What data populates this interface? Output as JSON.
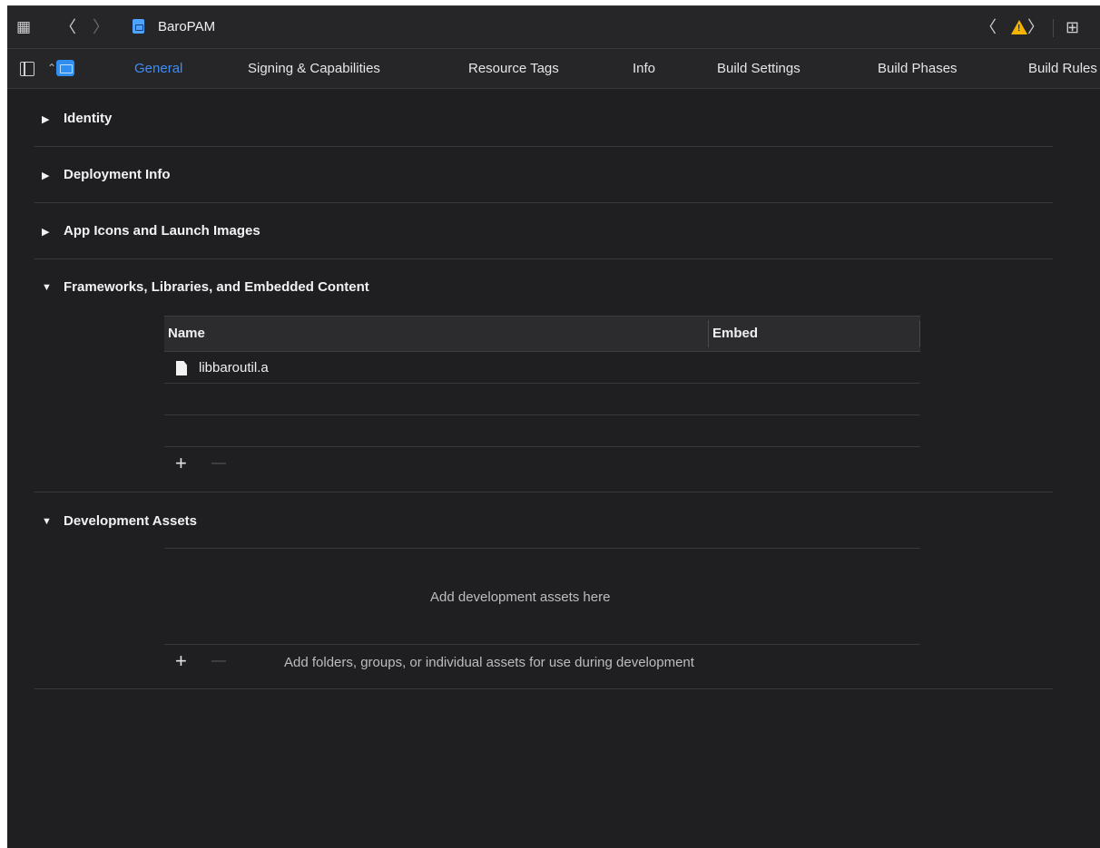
{
  "toolbar": {
    "project_name": "BaroPAM",
    "back_glyph": "〈",
    "forward_glyph": "〉",
    "grid_glyph": "▦",
    "issue_prev_glyph": "〈",
    "issue_next_glyph": "〉",
    "add_editor_glyph": "⊞"
  },
  "tabs": [
    {
      "label": "General",
      "active": true
    },
    {
      "label": "Signing & Capabilities",
      "active": false
    },
    {
      "label": "Resource Tags",
      "active": false
    },
    {
      "label": "Info",
      "active": false
    },
    {
      "label": "Build Settings",
      "active": false
    },
    {
      "label": "Build Phases",
      "active": false
    },
    {
      "label": "Build Rules",
      "active": false
    }
  ],
  "sections": [
    {
      "title": "Identity",
      "expanded": false
    },
    {
      "title": "Deployment Info",
      "expanded": false
    },
    {
      "title": "App Icons and Launch Images",
      "expanded": false
    },
    {
      "title": "Frameworks, Libraries, and Embedded Content",
      "expanded": true
    },
    {
      "title": "Development Assets",
      "expanded": true
    }
  ],
  "frameworks_table": {
    "columns": [
      "Name",
      "Embed"
    ],
    "rows": [
      {
        "name": "libbaroutil.a",
        "embed": ""
      }
    ],
    "add_glyph": "+",
    "remove_glyph": "—"
  },
  "development_assets": {
    "empty_message": "Add development assets here",
    "hint": "Add folders, groups, or individual assets for use during development",
    "add_glyph": "+",
    "remove_glyph": "—"
  },
  "glyphs": {
    "collapsed": "▶",
    "expanded": "▼",
    "warning": "!"
  },
  "colors": {
    "background": "#1f1f22",
    "accent": "#3d8df5",
    "warning": "#f5b400"
  }
}
